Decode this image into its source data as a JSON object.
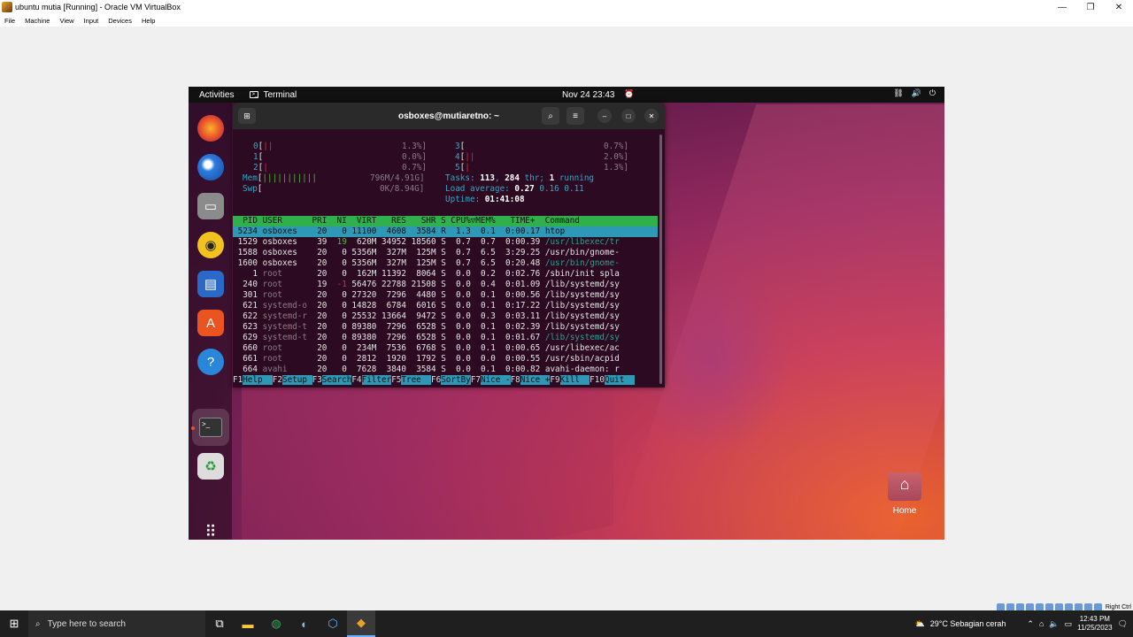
{
  "window": {
    "title": "ubuntu mutia [Running] - Oracle VM VirtualBox"
  },
  "menu": [
    "File",
    "Machine",
    "View",
    "Input",
    "Devices",
    "Help"
  ],
  "topbar": {
    "activities": "Activities",
    "app": "Terminal",
    "clock": "Nov 24  23:43"
  },
  "terminal": {
    "title": "osboxes@mutiaretno: ~"
  },
  "htop": {
    "cpus": [
      {
        "id": "0",
        "bar": "||",
        "pct": "1.3%]"
      },
      {
        "id": "1",
        "bar": "",
        "pct": "0.0%]"
      },
      {
        "id": "2",
        "bar": "|",
        "pct": "0.7%]"
      },
      {
        "id": "3",
        "bar": "",
        "pct": "0.7%]"
      },
      {
        "id": "4",
        "bar": "||",
        "pct": "2.0%]"
      },
      {
        "id": "5",
        "bar": "|",
        "pct": "1.3%]"
      }
    ],
    "mem": {
      "label": "Mem",
      "bar": "|||||||||||",
      "value": "796M/4.91G]"
    },
    "swp": {
      "label": "Swp",
      "bar": "",
      "value": "0K/8.94G]"
    },
    "tasks": {
      "label": "Tasks:",
      "tasks": "113",
      "thr": "284",
      "thr_label": "thr;",
      "running": "1",
      "running_label": "running"
    },
    "load": {
      "label": "Load average:",
      "v1": "0.27",
      "v2": "0.16",
      "v3": "0.11"
    },
    "uptime": {
      "label": "Uptime:",
      "value": "01:41:08"
    },
    "header": "  PID USER      PRI  NI  VIRT   RES   SHR S CPU%▽MEM%   TIME+  Command",
    "rows": [
      {
        "pid": " 5234",
        "user": "osboxes  ",
        "pri": " 20",
        "ni": "  0",
        "virt": "11100",
        "res": " 4608",
        "shr": " 3584",
        "s": "R",
        "cpu": " 1.3",
        "mem": " 0.1",
        "time": " 0:00.17",
        "cmd": "htop"
      },
      {
        "pid": " 1529",
        "user": "osboxes  ",
        "pri": " 39",
        "ni": " 19",
        "virt": " 620M",
        "res": "34952",
        "shr": "18560",
        "s": "S",
        "cpu": " 0.7",
        "mem": " 0.7",
        "time": " 0:00.39",
        "cmd": "/usr/libexec/tr"
      },
      {
        "pid": " 1588",
        "user": "osboxes  ",
        "pri": " 20",
        "ni": "  0",
        "virt": "5356M",
        "res": " 327M",
        "shr": " 125M",
        "s": "S",
        "cpu": " 0.7",
        "mem": " 6.5",
        "time": " 3:29.25",
        "cmd": "/usr/bin/gnome-"
      },
      {
        "pid": " 1600",
        "user": "osboxes  ",
        "pri": " 20",
        "ni": "  0",
        "virt": "5356M",
        "res": " 327M",
        "shr": " 125M",
        "s": "S",
        "cpu": " 0.7",
        "mem": " 6.5",
        "time": " 0:20.48",
        "cmd": "/usr/bin/gnome-"
      },
      {
        "pid": "    1",
        "user": "root     ",
        "pri": " 20",
        "ni": "  0",
        "virt": " 162M",
        "res": "11392",
        "shr": " 8064",
        "s": "S",
        "cpu": " 0.0",
        "mem": " 0.2",
        "time": " 0:02.76",
        "cmd": "/sbin/init spla"
      },
      {
        "pid": "  240",
        "user": "root     ",
        "pri": " 19",
        "ni": " -1",
        "virt": "56476",
        "res": "22788",
        "shr": "21508",
        "s": "S",
        "cpu": " 0.0",
        "mem": " 0.4",
        "time": " 0:01.09",
        "cmd": "/lib/systemd/sy"
      },
      {
        "pid": "  301",
        "user": "root     ",
        "pri": " 20",
        "ni": "  0",
        "virt": "27320",
        "res": " 7296",
        "shr": " 4480",
        "s": "S",
        "cpu": " 0.0",
        "mem": " 0.1",
        "time": " 0:00.56",
        "cmd": "/lib/systemd/sy"
      },
      {
        "pid": "  621",
        "user": "systemd-o",
        "pri": " 20",
        "ni": "  0",
        "virt": "14828",
        "res": " 6784",
        "shr": " 6016",
        "s": "S",
        "cpu": " 0.0",
        "mem": " 0.1",
        "time": " 0:17.22",
        "cmd": "/lib/systemd/sy"
      },
      {
        "pid": "  622",
        "user": "systemd-r",
        "pri": " 20",
        "ni": "  0",
        "virt": "25532",
        "res": "13664",
        "shr": " 9472",
        "s": "S",
        "cpu": " 0.0",
        "mem": " 0.3",
        "time": " 0:03.11",
        "cmd": "/lib/systemd/sy"
      },
      {
        "pid": "  623",
        "user": "systemd-t",
        "pri": " 20",
        "ni": "  0",
        "virt": "89380",
        "res": " 7296",
        "shr": " 6528",
        "s": "S",
        "cpu": " 0.0",
        "mem": " 0.1",
        "time": " 0:02.39",
        "cmd": "/lib/systemd/sy"
      },
      {
        "pid": "  629",
        "user": "systemd-t",
        "pri": " 20",
        "ni": "  0",
        "virt": "89380",
        "res": " 7296",
        "shr": " 6528",
        "s": "S",
        "cpu": " 0.0",
        "mem": " 0.1",
        "time": " 0:01.67",
        "cmd": "/lib/systemd/sy"
      },
      {
        "pid": "  660",
        "user": "root     ",
        "pri": " 20",
        "ni": "  0",
        "virt": " 234M",
        "res": " 7536",
        "shr": " 6768",
        "s": "S",
        "cpu": " 0.0",
        "mem": " 0.1",
        "time": " 0:00.65",
        "cmd": "/usr/libexec/ac"
      },
      {
        "pid": "  661",
        "user": "root     ",
        "pri": " 20",
        "ni": "  0",
        "virt": " 2812",
        "res": " 1920",
        "shr": " 1792",
        "s": "S",
        "cpu": " 0.0",
        "mem": " 0.0",
        "time": " 0:00.55",
        "cmd": "/usr/sbin/acpid"
      },
      {
        "pid": "  664",
        "user": "avahi    ",
        "pri": " 20",
        "ni": "  0",
        "virt": " 7628",
        "res": " 3840",
        "shr": " 3584",
        "s": "S",
        "cpu": " 0.0",
        "mem": " 0.1",
        "time": " 0:00.82",
        "cmd": "avahi-daemon: r"
      }
    ],
    "fkeys": [
      {
        "k": "F1",
        "v": "Help  "
      },
      {
        "k": "F2",
        "v": "Setup "
      },
      {
        "k": "F3",
        "v": "Search"
      },
      {
        "k": "F4",
        "v": "Filter"
      },
      {
        "k": "F5",
        "v": "Tree  "
      },
      {
        "k": "F6",
        "v": "SortBy"
      },
      {
        "k": "F7",
        "v": "Nice -"
      },
      {
        "k": "F8",
        "v": "Nice +"
      },
      {
        "k": "F9",
        "v": "Kill  "
      },
      {
        "k": "F10",
        "v": "Quit  "
      }
    ]
  },
  "desktop": {
    "home_label": "Home"
  },
  "taskbar": {
    "search_placeholder": "Type here to search",
    "weather": "29°C  Sebagian cerah",
    "time": "12:43 PM",
    "date": "11/25/2023"
  },
  "vbox_status": {
    "host_key": "Right Ctrl"
  }
}
